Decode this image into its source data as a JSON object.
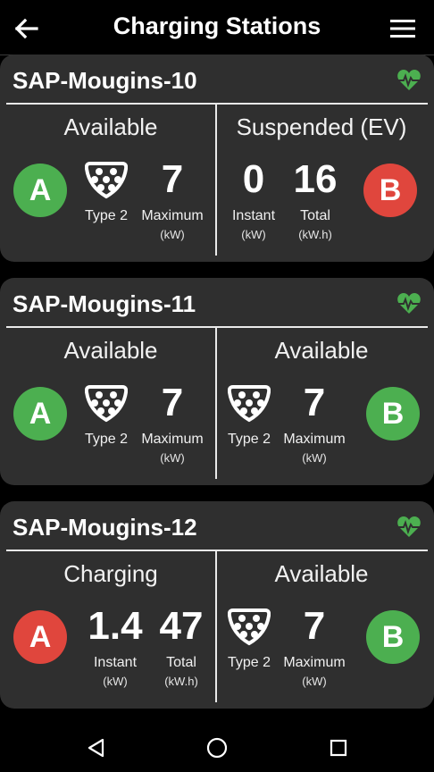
{
  "header": {
    "title": "Charging Stations",
    "back_icon": "arrow-left-icon",
    "menu_icon": "hamburger-menu-icon"
  },
  "colors": {
    "available": "#4caf50",
    "busy": "#e0463d",
    "heartbeat": "#4caf50",
    "card_bg": "#2f2f2f"
  },
  "stations": [
    {
      "name": "SAP-Mougins-10",
      "left": {
        "status": "Available",
        "plug_label": "Type 2",
        "value": "7",
        "value_label": "Maximum",
        "value_unit": "(kW)",
        "badge": "A"
      },
      "right": {
        "status": "Suspended (EV)",
        "value1": "0",
        "value1_label": "Instant",
        "value1_unit": "(kW)",
        "value2": "16",
        "value2_label": "Total",
        "value2_unit": "(kW.h)",
        "badge": "B"
      }
    },
    {
      "name": "SAP-Mougins-11",
      "left": {
        "status": "Available",
        "plug_label": "Type 2",
        "value": "7",
        "value_label": "Maximum",
        "value_unit": "(kW)",
        "badge": "A"
      },
      "right": {
        "status": "Available",
        "plug_label": "Type 2",
        "value": "7",
        "value_label": "Maximum",
        "value_unit": "(kW)",
        "badge": "B"
      }
    },
    {
      "name": "SAP-Mougins-12",
      "left": {
        "status": "Charging",
        "value1": "1.4",
        "value1_label": "Instant",
        "value1_unit": "(kW)",
        "value2": "47",
        "value2_label": "Total",
        "value2_unit": "(kW.h)",
        "badge": "A"
      },
      "right": {
        "status": "Available",
        "plug_label": "Type 2",
        "value": "7",
        "value_label": "Maximum",
        "value_unit": "(kW)",
        "badge": "B"
      }
    }
  ]
}
